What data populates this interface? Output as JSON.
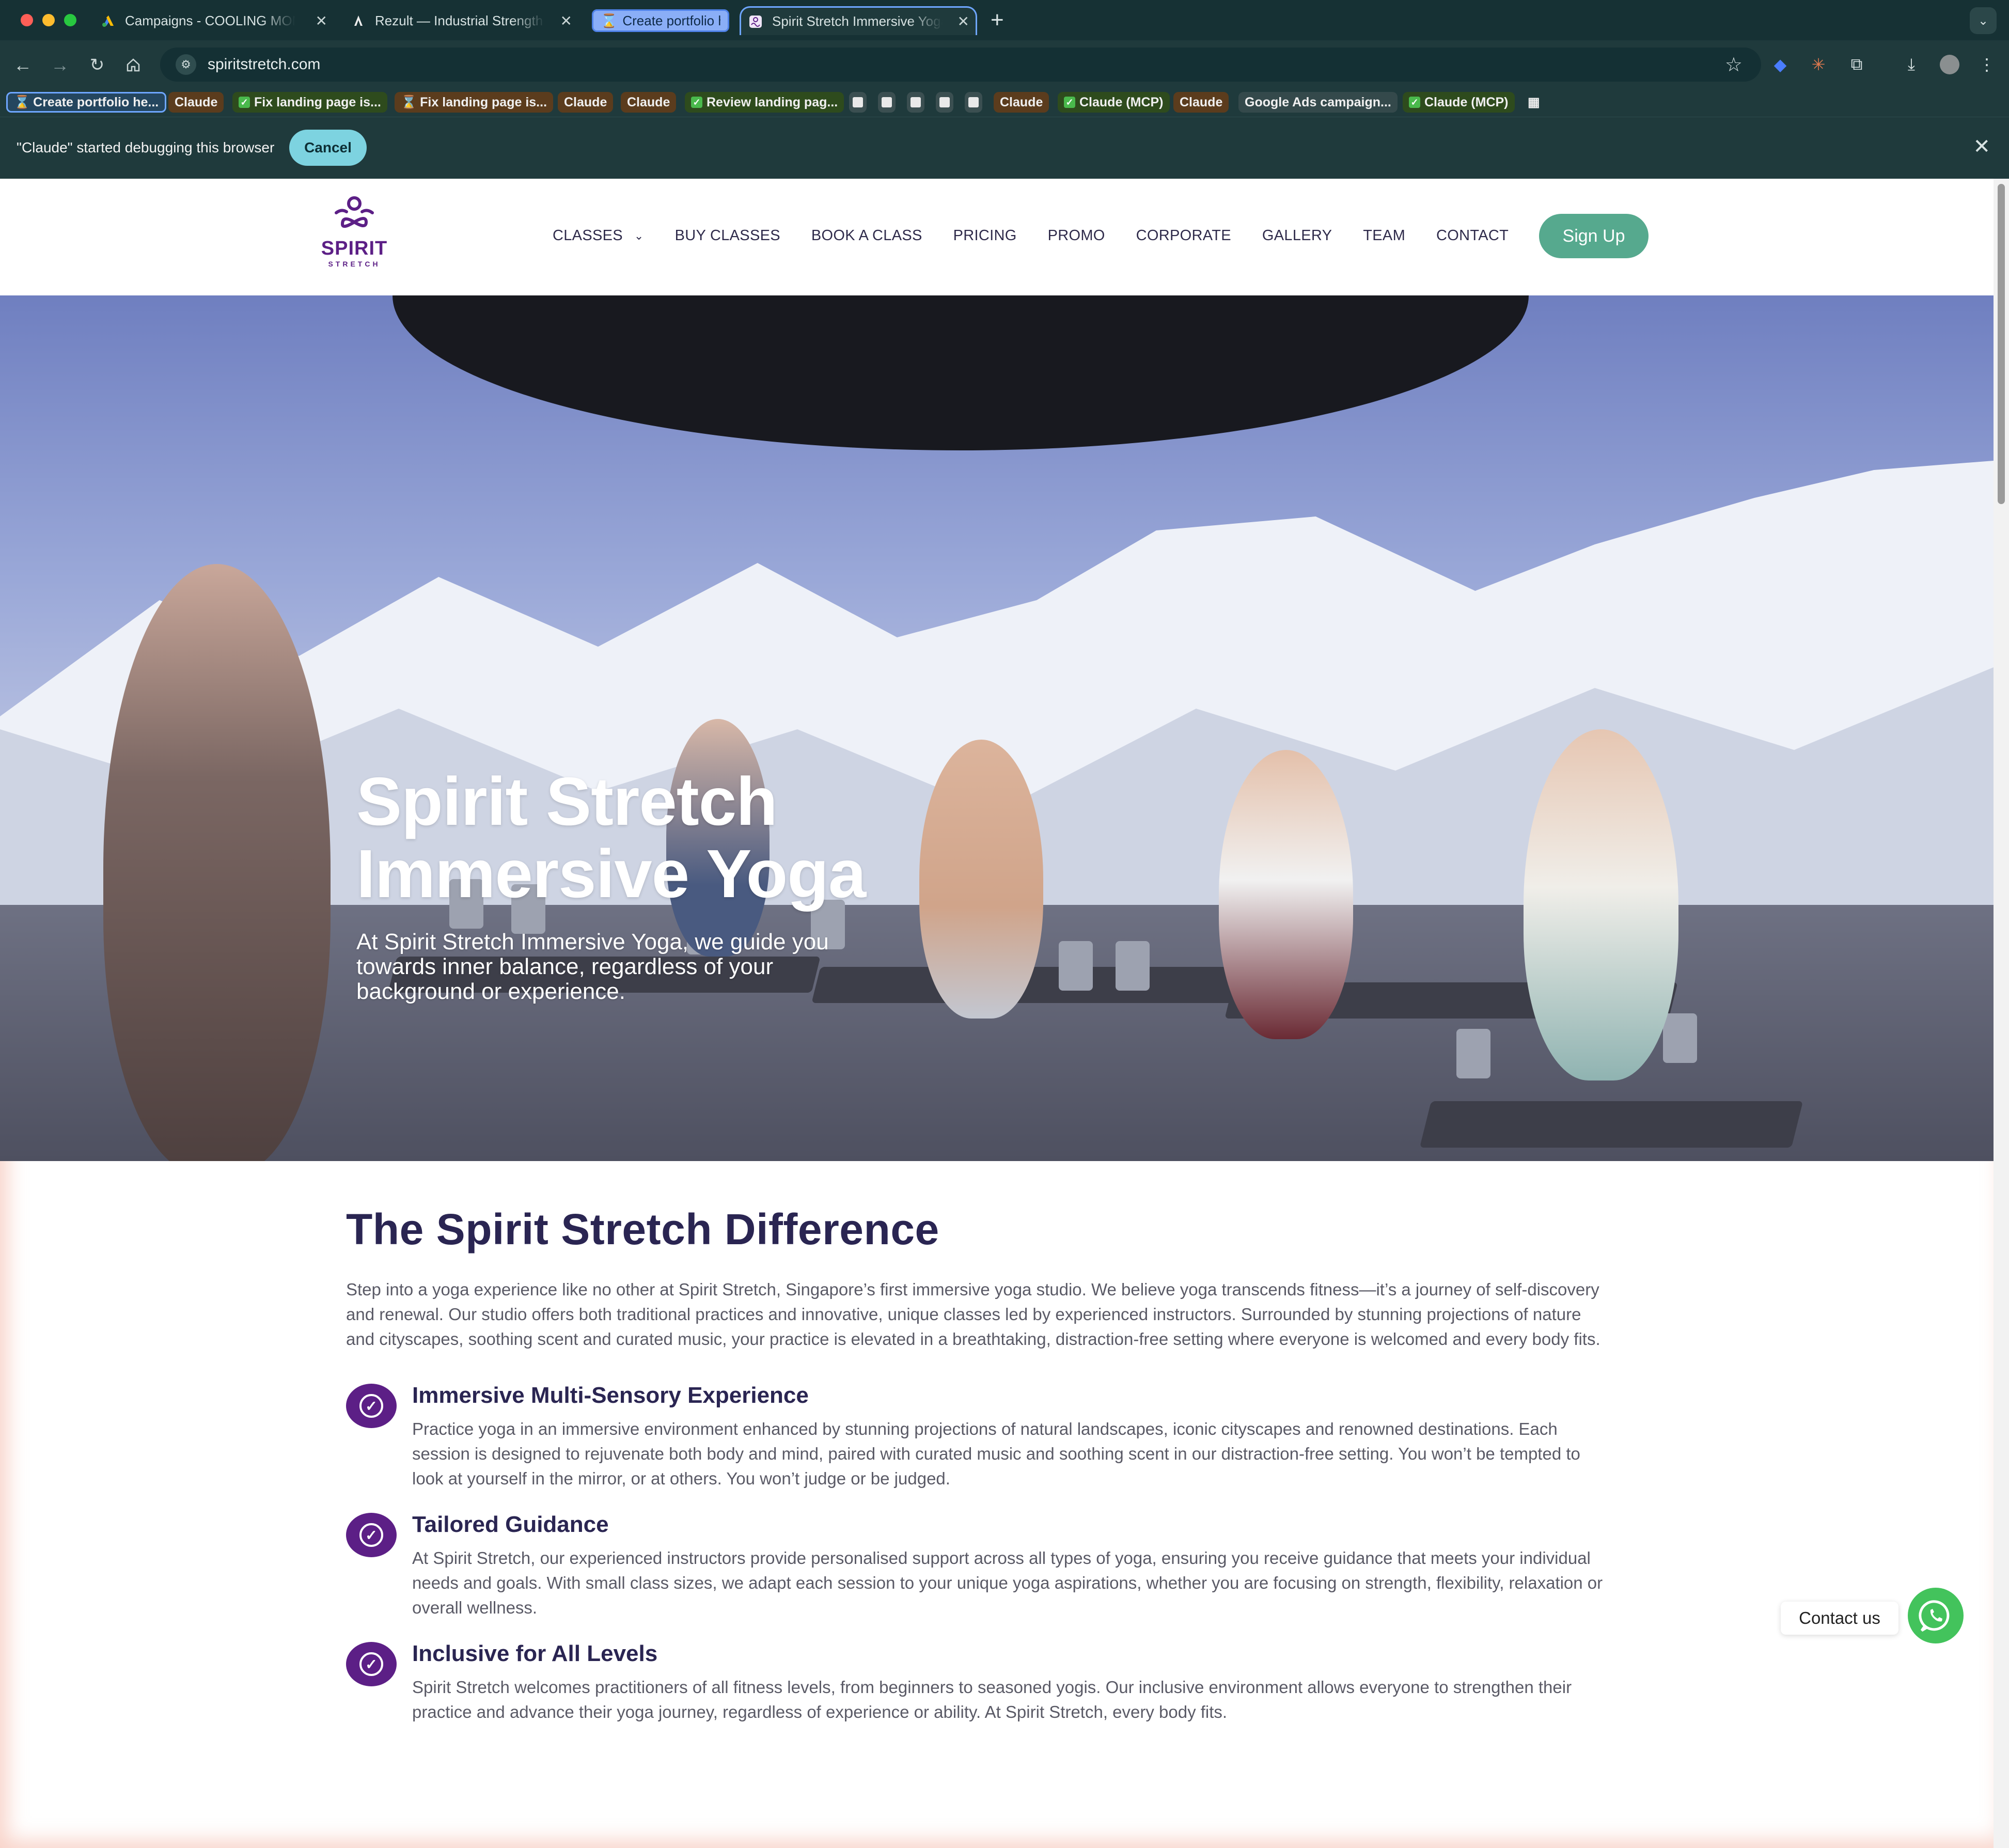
{
  "browser": {
    "tabs": [
      {
        "label": "Campaigns - COOLING MON",
        "icon": "google-ads-icon"
      },
      {
        "label": "Rezult — Industrial Strength C",
        "icon": "claude-icon"
      },
      {
        "label": "Create portfolio h",
        "icon": "hourglass-icon",
        "grouped": true
      },
      {
        "label": "Spirit Stretch Immersive Yoga",
        "icon": "spirit-favicon",
        "active": true
      }
    ],
    "url": "spiritstretch.com",
    "bookmarks": [
      {
        "label": "Create portfolio he...",
        "style": "blue",
        "icon": "hourglass-icon"
      },
      {
        "label": "Claude",
        "style": "orange"
      },
      {
        "label": "Fix landing page is...",
        "style": "green",
        "icon": "check-icon"
      },
      {
        "label": "Fix landing page is...",
        "style": "orange",
        "icon": "hourglass-icon"
      },
      {
        "label": "Claude",
        "style": "orange"
      },
      {
        "label": "Claude",
        "style": "orange"
      },
      {
        "label": "Review landing pag...",
        "style": "green",
        "icon": "check-icon"
      },
      {
        "label": "Claude",
        "style": "orange"
      },
      {
        "label": "Claude (MCP)",
        "style": "green",
        "icon": "check-icon"
      },
      {
        "label": "Claude",
        "style": "orange"
      },
      {
        "label": "Google Ads campaign...",
        "style": "gray-text"
      },
      {
        "label": "Claude (MCP)",
        "style": "green",
        "icon": "check-icon"
      }
    ],
    "infobar": {
      "message": "\"Claude\" started debugging this browser",
      "cancel": "Cancel"
    }
  },
  "site": {
    "logo": {
      "word": "SPIRIT",
      "sub": "STRETCH"
    },
    "nav": [
      {
        "label": "CLASSES",
        "dropdown": true
      },
      {
        "label": "BUY CLASSES"
      },
      {
        "label": "BOOK A CLASS"
      },
      {
        "label": "PRICING"
      },
      {
        "label": "PROMO"
      },
      {
        "label": "CORPORATE"
      },
      {
        "label": "GALLERY"
      },
      {
        "label": "TEAM"
      },
      {
        "label": "CONTACT"
      }
    ],
    "signup": "Sign Up",
    "hero": {
      "title_line1": "Spirit Stretch",
      "title_line2": "Immersive Yoga",
      "subtitle": "At Spirit Stretch Immersive Yoga, we guide you towards inner balance, regardless of your background or experience."
    },
    "difference": {
      "title": "The Spirit Stretch Difference",
      "intro": "Step into a yoga experience like no other at Spirit Stretch, Singapore’s first immersive yoga studio. We believe yoga transcends fitness—it’s a journey of self-discovery and renewal. Our studio offers both traditional practices and innovative, unique classes led by experienced instructors. Surrounded by stunning projections of nature and cityscapes, soothing scent and curated music, your practice is elevated in a breathtaking, distraction-free setting where everyone is welcomed and every body fits.",
      "features": [
        {
          "title": "Immersive Multi-Sensory Experience",
          "text": "Practice yoga in an immersive environment enhanced by stunning projections of natural landscapes, iconic cityscapes and renowned destinations. Each session is designed to rejuvenate both body and mind, paired with curated music and soothing scent in our distraction-free setting. You won’t be tempted to look at yourself in the mirror, or at others. You won’t judge or be judged."
        },
        {
          "title": "Tailored Guidance",
          "text": "At Spirit Stretch, our experienced instructors provide personalised support across all types of yoga, ensuring you receive guidance that meets your individual needs and goals. With small class sizes, we adapt each session to your unique yoga aspirations, whether you are focusing on strength, flexibility, relaxation or overall wellness."
        },
        {
          "title": "Inclusive for All Levels",
          "text": "Spirit Stretch welcomes practitioners of all fitness levels, from beginners to seasoned yogis. Our inclusive environment allows everyone to strengthen their practice and advance their yoga journey, regardless of experience or ability. At Spirit Stretch, every body fits."
        }
      ]
    },
    "contact_widget": "Contact us"
  },
  "colors": {
    "brand_purple": "#5c1f86",
    "signup_green": "#56a98e",
    "heading_navy": "#2a2552",
    "whatsapp_green": "#43c35c"
  }
}
